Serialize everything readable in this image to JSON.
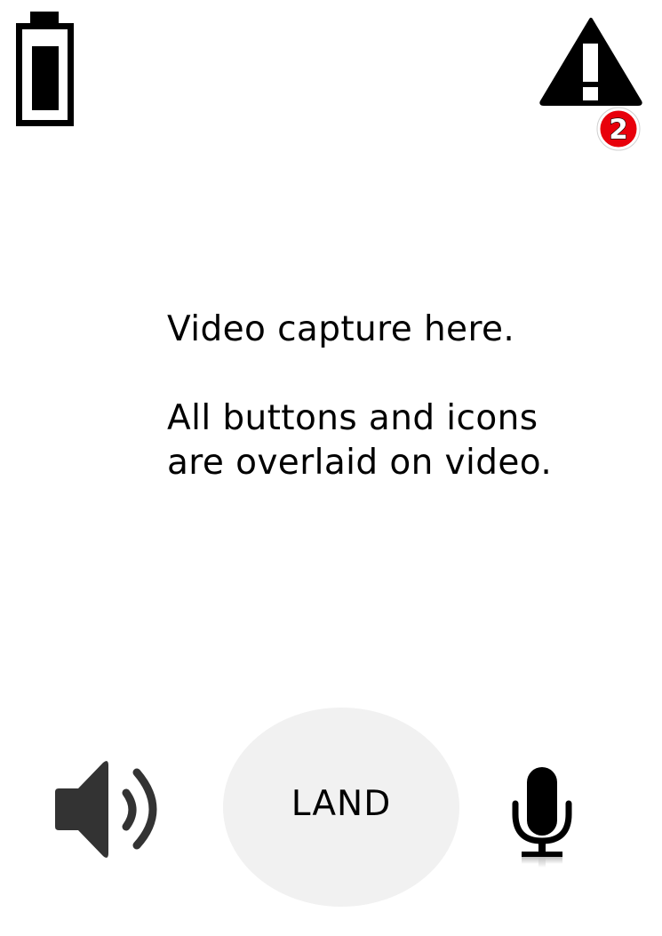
{
  "video": {
    "caption_line1": "Video capture here.",
    "caption_line2": "All buttons and icons",
    "caption_line3": "are overlaid on video."
  },
  "status": {
    "battery_icon": "battery-icon",
    "battery_level": 0.8,
    "warning_icon": "warning-icon",
    "warning_count": "2",
    "badge_color": "#e8000b"
  },
  "controls": {
    "speaker_icon": "speaker-icon",
    "land_label": "LAND",
    "mic_icon": "microphone-icon",
    "land_bg": "#f1f1f1"
  }
}
